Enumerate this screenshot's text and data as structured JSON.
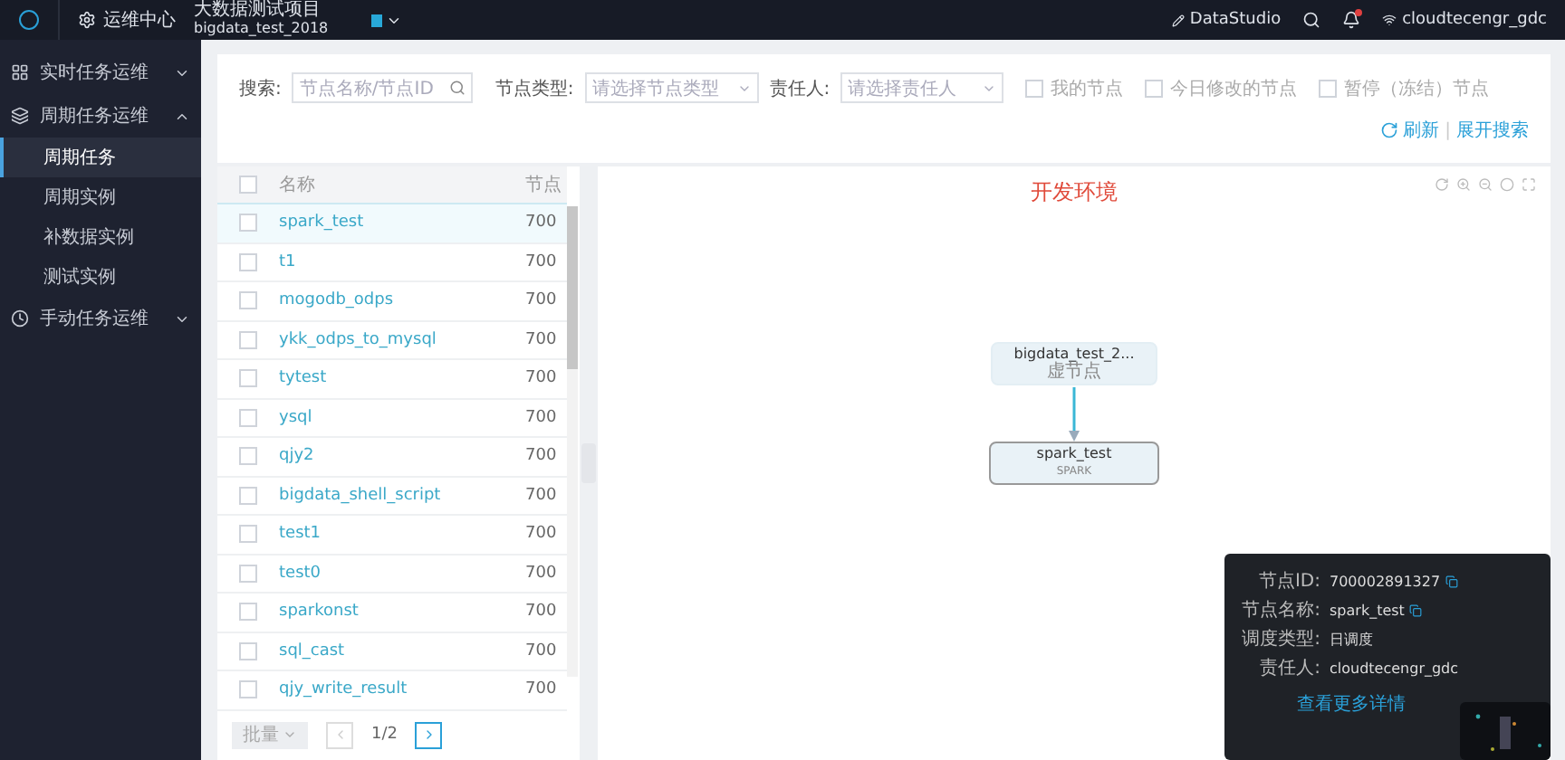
{
  "header": {
    "module": "运维中心",
    "project_name": "大数据测试项目",
    "project_id": "bigdata_test_2018",
    "link": "DataStudio",
    "user": "cloudtecengr_gdc"
  },
  "sidebar": {
    "groups": [
      {
        "label": "实时任务运维",
        "expanded": false
      },
      {
        "label": "周期任务运维",
        "expanded": true,
        "children": [
          {
            "label": "周期任务",
            "selected": true
          },
          {
            "label": "周期实例",
            "selected": false
          },
          {
            "label": "补数据实例",
            "selected": false
          },
          {
            "label": "测试实例",
            "selected": false
          }
        ]
      },
      {
        "label": "手动任务运维",
        "expanded": false
      }
    ]
  },
  "filters": {
    "search": {
      "label": "搜索:",
      "placeholder": "节点名称/节点ID"
    },
    "node_type": {
      "label": "节点类型:",
      "placeholder": "请选择节点类型"
    },
    "owner": {
      "label": "责任人:",
      "placeholder": "请选择责任人"
    },
    "checkboxes": [
      {
        "label": "我的节点",
        "checked": false
      },
      {
        "label": "今日修改的节点",
        "checked": false
      },
      {
        "label": "暂停（冻结）节点",
        "checked": false
      }
    ],
    "refresh": "刷新",
    "separator": "|",
    "expand": "展开搜索"
  },
  "table": {
    "select_all_checked": false,
    "columns": [
      "名称",
      "节点"
    ],
    "rows": [
      {
        "name": "spark_test",
        "column_2": "700",
        "selected": true,
        "checked": false
      },
      {
        "name": "t1",
        "column_2": "700",
        "selected": false,
        "checked": false
      },
      {
        "name": "mogodb_odps",
        "column_2": "700",
        "selected": false,
        "checked": false
      },
      {
        "name": "ykk_odps_to_mysql",
        "column_2": "700",
        "selected": false,
        "checked": false
      },
      {
        "name": "tytest",
        "column_2": "700",
        "selected": false,
        "checked": false
      },
      {
        "name": "ysql",
        "column_2": "700",
        "selected": false,
        "checked": false
      },
      {
        "name": "qjy2",
        "column_2": "700",
        "selected": false,
        "checked": false
      },
      {
        "name": "bigdata_shell_script",
        "column_2": "700",
        "selected": false,
        "checked": false
      },
      {
        "name": "test1",
        "column_2": "700",
        "selected": false,
        "checked": false
      },
      {
        "name": "test0",
        "column_2": "700",
        "selected": false,
        "checked": false
      },
      {
        "name": "sparkonst",
        "column_2": "700",
        "selected": false,
        "checked": false
      },
      {
        "name": "sql_cast",
        "column_2": "700",
        "selected": false,
        "checked": false
      },
      {
        "name": "qjy_write_result",
        "column_2": "700",
        "selected": false,
        "checked": false
      }
    ],
    "pager": {
      "batch": "批量",
      "page": "1/2"
    }
  },
  "graph": {
    "title": "开发环境",
    "nodes": [
      {
        "name": "bigdata_test_2...",
        "type": "虚节点",
        "selected": false
      },
      {
        "name": "spark_test",
        "type": "SPARK",
        "selected": true
      }
    ]
  },
  "popup": {
    "fields": [
      {
        "label": "节点ID:",
        "value": "700002891327",
        "copy": true
      },
      {
        "label": "节点名称:",
        "value": "spark_test",
        "copy": true
      },
      {
        "label": "调度类型:",
        "value": "日调度",
        "copy": false
      },
      {
        "label": "责任人:",
        "value": "cloudtecengr_gdc",
        "copy": false
      }
    ],
    "link": "查看更多详情"
  }
}
